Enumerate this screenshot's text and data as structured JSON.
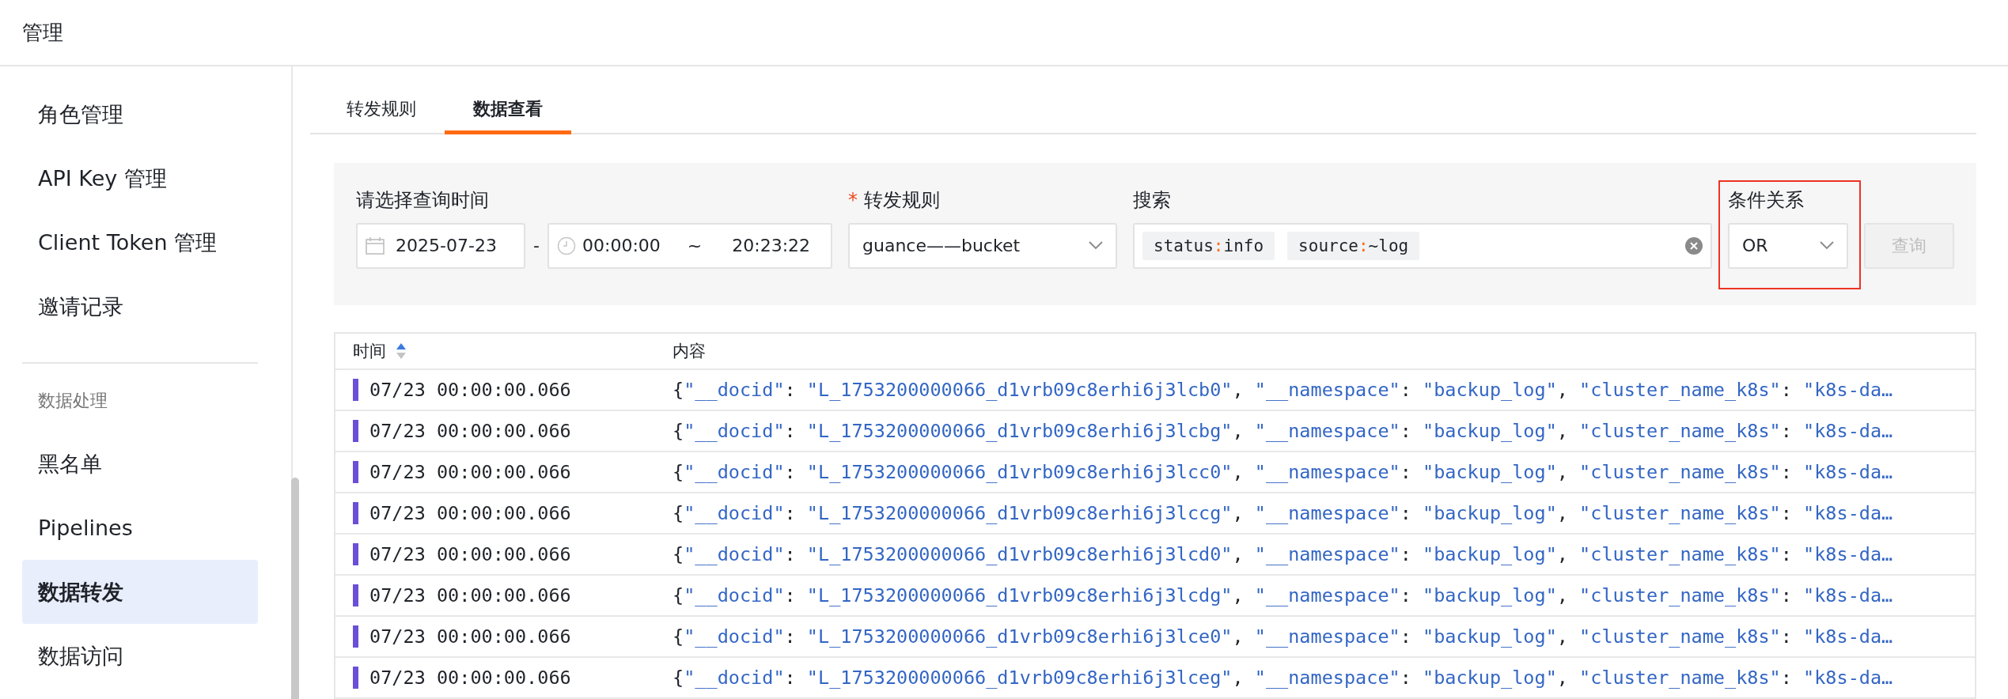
{
  "header": {
    "title": "管理"
  },
  "sidebar": {
    "groups": [
      {
        "items": [
          {
            "label": "角色管理",
            "selected": false
          },
          {
            "label": "API Key 管理",
            "selected": false
          },
          {
            "label": "Client Token 管理",
            "selected": false
          },
          {
            "label": "邀请记录",
            "selected": false
          }
        ]
      },
      {
        "title": "数据处理",
        "items": [
          {
            "label": "黑名单",
            "selected": false
          },
          {
            "label": "Pipelines",
            "selected": false
          },
          {
            "label": "数据转发",
            "selected": true
          },
          {
            "label": "数据访问",
            "selected": false
          }
        ]
      }
    ]
  },
  "tabs": [
    {
      "label": "转发规则",
      "selected": false
    },
    {
      "label": "数据查看",
      "selected": true
    }
  ],
  "filters": {
    "time": {
      "label": "请选择查询时间",
      "date": "2025-07-23",
      "separator": "-",
      "start": "00:00:00",
      "tilde": "~",
      "end": "20:23:22"
    },
    "rule": {
      "label": "转发规则",
      "required_mark": "*",
      "value": "guance——bucket"
    },
    "search": {
      "label": "搜索",
      "tokens": [
        {
          "key": "status",
          "op": ":",
          "value": "info"
        },
        {
          "key": "source",
          "op": ":",
          "value": "~log"
        }
      ]
    },
    "condition": {
      "label": "条件关系",
      "value": "OR",
      "highlighted": true
    },
    "query_button": {
      "label": "查询",
      "disabled": true
    }
  },
  "table": {
    "columns": [
      "时间",
      "内容"
    ],
    "rows": [
      {
        "time": "07/23 00:00:00.066",
        "color": "#6b4fd6",
        "content": [
          {
            "kind": "punct",
            "text": "{"
          },
          {
            "kind": "string",
            "text": "\"__docid\""
          },
          {
            "kind": "punct",
            "text": ": "
          },
          {
            "kind": "string",
            "text": "\"L_1753200000066_d1vrb09c8erhi6j3lcb0\""
          },
          {
            "kind": "punct",
            "text": ", "
          },
          {
            "kind": "string",
            "text": "\"__namespace\""
          },
          {
            "kind": "punct",
            "text": ": "
          },
          {
            "kind": "string",
            "text": "\"backup_log\""
          },
          {
            "kind": "punct",
            "text": ", "
          },
          {
            "kind": "string",
            "text": "\"cluster_name_k8s\""
          },
          {
            "kind": "punct",
            "text": ": "
          },
          {
            "kind": "string",
            "text": "\"k8s-da…"
          }
        ]
      },
      {
        "time": "07/23 00:00:00.066",
        "color": "#6b4fd6",
        "content": [
          {
            "kind": "punct",
            "text": "{"
          },
          {
            "kind": "string",
            "text": "\"__docid\""
          },
          {
            "kind": "punct",
            "text": ": "
          },
          {
            "kind": "string",
            "text": "\"L_1753200000066_d1vrb09c8erhi6j3lcbg\""
          },
          {
            "kind": "punct",
            "text": ", "
          },
          {
            "kind": "string",
            "text": "\"__namespace\""
          },
          {
            "kind": "punct",
            "text": ": "
          },
          {
            "kind": "string",
            "text": "\"backup_log\""
          },
          {
            "kind": "punct",
            "text": ", "
          },
          {
            "kind": "string",
            "text": "\"cluster_name_k8s\""
          },
          {
            "kind": "punct",
            "text": ": "
          },
          {
            "kind": "string",
            "text": "\"k8s-da…"
          }
        ]
      },
      {
        "time": "07/23 00:00:00.066",
        "color": "#6b4fd6",
        "content": [
          {
            "kind": "punct",
            "text": "{"
          },
          {
            "kind": "string",
            "text": "\"__docid\""
          },
          {
            "kind": "punct",
            "text": ": "
          },
          {
            "kind": "string",
            "text": "\"L_1753200000066_d1vrb09c8erhi6j3lcc0\""
          },
          {
            "kind": "punct",
            "text": ", "
          },
          {
            "kind": "string",
            "text": "\"__namespace\""
          },
          {
            "kind": "punct",
            "text": ": "
          },
          {
            "kind": "string",
            "text": "\"backup_log\""
          },
          {
            "kind": "punct",
            "text": ", "
          },
          {
            "kind": "string",
            "text": "\"cluster_name_k8s\""
          },
          {
            "kind": "punct",
            "text": ": "
          },
          {
            "kind": "string",
            "text": "\"k8s-da…"
          }
        ]
      },
      {
        "time": "07/23 00:00:00.066",
        "color": "#6b4fd6",
        "content": [
          {
            "kind": "punct",
            "text": "{"
          },
          {
            "kind": "string",
            "text": "\"__docid\""
          },
          {
            "kind": "punct",
            "text": ": "
          },
          {
            "kind": "string",
            "text": "\"L_1753200000066_d1vrb09c8erhi6j3lccg\""
          },
          {
            "kind": "punct",
            "text": ", "
          },
          {
            "kind": "string",
            "text": "\"__namespace\""
          },
          {
            "kind": "punct",
            "text": ": "
          },
          {
            "kind": "string",
            "text": "\"backup_log\""
          },
          {
            "kind": "punct",
            "text": ", "
          },
          {
            "kind": "string",
            "text": "\"cluster_name_k8s\""
          },
          {
            "kind": "punct",
            "text": ": "
          },
          {
            "kind": "string",
            "text": "\"k8s-da…"
          }
        ]
      },
      {
        "time": "07/23 00:00:00.066",
        "color": "#6b4fd6",
        "content": [
          {
            "kind": "punct",
            "text": "{"
          },
          {
            "kind": "string",
            "text": "\"__docid\""
          },
          {
            "kind": "punct",
            "text": ": "
          },
          {
            "kind": "string",
            "text": "\"L_1753200000066_d1vrb09c8erhi6j3lcd0\""
          },
          {
            "kind": "punct",
            "text": ", "
          },
          {
            "kind": "string",
            "text": "\"__namespace\""
          },
          {
            "kind": "punct",
            "text": ": "
          },
          {
            "kind": "string",
            "text": "\"backup_log\""
          },
          {
            "kind": "punct",
            "text": ", "
          },
          {
            "kind": "string",
            "text": "\"cluster_name_k8s\""
          },
          {
            "kind": "punct",
            "text": ": "
          },
          {
            "kind": "string",
            "text": "\"k8s-da…"
          }
        ]
      },
      {
        "time": "07/23 00:00:00.066",
        "color": "#6b4fd6",
        "content": [
          {
            "kind": "punct",
            "text": "{"
          },
          {
            "kind": "string",
            "text": "\"__docid\""
          },
          {
            "kind": "punct",
            "text": ": "
          },
          {
            "kind": "string",
            "text": "\"L_1753200000066_d1vrb09c8erhi6j3lcdg\""
          },
          {
            "kind": "punct",
            "text": ", "
          },
          {
            "kind": "string",
            "text": "\"__namespace\""
          },
          {
            "kind": "punct",
            "text": ": "
          },
          {
            "kind": "string",
            "text": "\"backup_log\""
          },
          {
            "kind": "punct",
            "text": ", "
          },
          {
            "kind": "string",
            "text": "\"cluster_name_k8s\""
          },
          {
            "kind": "punct",
            "text": ": "
          },
          {
            "kind": "string",
            "text": "\"k8s-da…"
          }
        ]
      },
      {
        "time": "07/23 00:00:00.066",
        "color": "#6b4fd6",
        "content": [
          {
            "kind": "punct",
            "text": "{"
          },
          {
            "kind": "string",
            "text": "\"__docid\""
          },
          {
            "kind": "punct",
            "text": ": "
          },
          {
            "kind": "string",
            "text": "\"L_1753200000066_d1vrb09c8erhi6j3lce0\""
          },
          {
            "kind": "punct",
            "text": ", "
          },
          {
            "kind": "string",
            "text": "\"__namespace\""
          },
          {
            "kind": "punct",
            "text": ": "
          },
          {
            "kind": "string",
            "text": "\"backup_log\""
          },
          {
            "kind": "punct",
            "text": ", "
          },
          {
            "kind": "string",
            "text": "\"cluster_name_k8s\""
          },
          {
            "kind": "punct",
            "text": ": "
          },
          {
            "kind": "string",
            "text": "\"k8s-da…"
          }
        ]
      },
      {
        "time": "07/23 00:00:00.066",
        "color": "#6b4fd6",
        "content": [
          {
            "kind": "punct",
            "text": "{"
          },
          {
            "kind": "string",
            "text": "\"__docid\""
          },
          {
            "kind": "punct",
            "text": ": "
          },
          {
            "kind": "string",
            "text": "\"L_1753200000066_d1vrb09c8erhi6j3lceg\""
          },
          {
            "kind": "punct",
            "text": ", "
          },
          {
            "kind": "string",
            "text": "\"__namespace\""
          },
          {
            "kind": "punct",
            "text": ": "
          },
          {
            "kind": "string",
            "text": "\"backup_log\""
          },
          {
            "kind": "punct",
            "text": ", "
          },
          {
            "kind": "string",
            "text": "\"cluster_name_k8s\""
          },
          {
            "kind": "punct",
            "text": ": "
          },
          {
            "kind": "string",
            "text": "\"k8s-da…"
          }
        ]
      }
    ]
  }
}
